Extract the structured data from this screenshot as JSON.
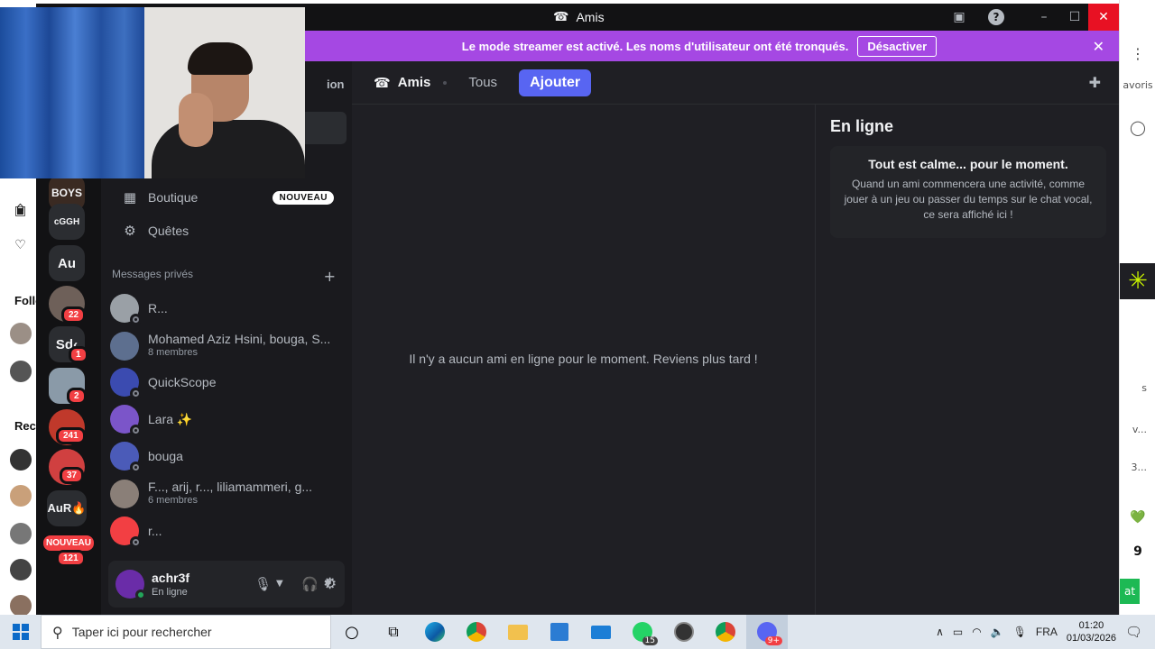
{
  "window": {
    "title": "Amis"
  },
  "banner": {
    "text": "Le mode streamer est activé. Les noms d'utilisateur ont été tronqués.",
    "button": "Désactiver"
  },
  "servers": [
    {
      "label": "BOYS"
    },
    {
      "label": "cGGH"
    },
    {
      "label": "Au"
    },
    {
      "label": "",
      "badge": "22"
    },
    {
      "label": "Sd‹",
      "badge": "1"
    },
    {
      "label": "",
      "badge": "2"
    },
    {
      "label": "",
      "badge": "241"
    },
    {
      "label": "",
      "badge": "37"
    },
    {
      "label": "AuR🔥"
    },
    {
      "label": "NOUVEAU",
      "badge": "121"
    }
  ],
  "sidebar": {
    "partial_item": "ion",
    "items": [
      {
        "label": "Boutique",
        "badge": "NOUVEAU"
      },
      {
        "label": "Quêtes"
      }
    ],
    "section_title": "Messages privés",
    "dms": [
      {
        "name": "R...",
        "sub": "",
        "color": "#9aa0a6"
      },
      {
        "name": "Mohamed Aziz Hsini, bouga, S...",
        "sub": "8 membres",
        "color": "#5d6f8f"
      },
      {
        "name": "QuickScope",
        "sub": "",
        "color": "#3b4bb0"
      },
      {
        "name": "Lara ✨",
        "sub": "",
        "color": "#7b55c9"
      },
      {
        "name": "bouga",
        "sub": "",
        "color": "#4b5bb8"
      },
      {
        "name": "F..., arij, r..., liliamammeri, g...",
        "sub": "6 membres",
        "color": "#8a7f78"
      },
      {
        "name": "r...",
        "sub": "",
        "color": "#f23f43"
      }
    ]
  },
  "user": {
    "name": "achr3f",
    "status": "En ligne"
  },
  "header": {
    "title": "Amis",
    "tabs": [
      "Tous"
    ],
    "add_button": "Ajouter"
  },
  "main": {
    "empty_message": "Il n'y a aucun ami en ligne pour le moment. Reviens plus tard !"
  },
  "activity": {
    "title": "En ligne",
    "card_title": "Tout est calme... pour le moment.",
    "card_text": "Quand un ami commencera une activité, comme jouer à un jeu ou passer du temps sur le chat vocal, ce sera affiché ici !"
  },
  "background": {
    "left_labels": [
      "Follo",
      "Rech"
    ],
    "right_labels": [
      "avoris",
      "s",
      "v...",
      "3...",
      "at"
    ]
  },
  "taskbar": {
    "search_placeholder": "Taper ici pour rechercher",
    "whatsapp_badge": "15",
    "discord_badge": "9+",
    "language": "FRA",
    "time": "01:20",
    "date": "01/03/2026"
  }
}
